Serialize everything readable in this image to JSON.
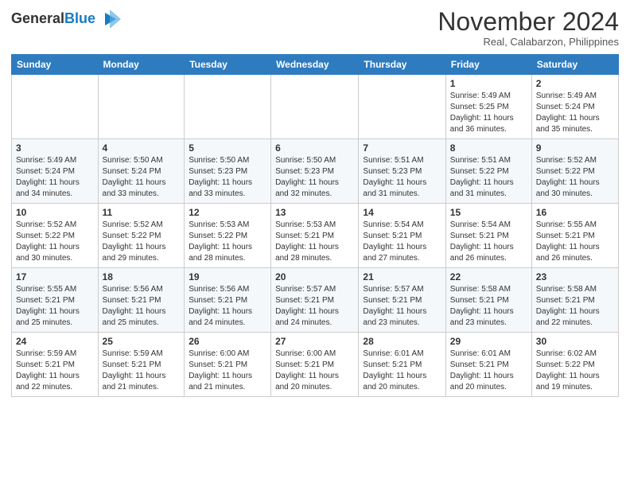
{
  "header": {
    "logo_general": "General",
    "logo_blue": "Blue",
    "month_title": "November 2024",
    "location": "Real, Calabarzon, Philippines"
  },
  "days_of_week": [
    "Sunday",
    "Monday",
    "Tuesday",
    "Wednesday",
    "Thursday",
    "Friday",
    "Saturday"
  ],
  "weeks": [
    [
      {
        "day": "",
        "info": ""
      },
      {
        "day": "",
        "info": ""
      },
      {
        "day": "",
        "info": ""
      },
      {
        "day": "",
        "info": ""
      },
      {
        "day": "",
        "info": ""
      },
      {
        "day": "1",
        "info": "Sunrise: 5:49 AM\nSunset: 5:25 PM\nDaylight: 11 hours\nand 36 minutes."
      },
      {
        "day": "2",
        "info": "Sunrise: 5:49 AM\nSunset: 5:24 PM\nDaylight: 11 hours\nand 35 minutes."
      }
    ],
    [
      {
        "day": "3",
        "info": "Sunrise: 5:49 AM\nSunset: 5:24 PM\nDaylight: 11 hours\nand 34 minutes."
      },
      {
        "day": "4",
        "info": "Sunrise: 5:50 AM\nSunset: 5:24 PM\nDaylight: 11 hours\nand 33 minutes."
      },
      {
        "day": "5",
        "info": "Sunrise: 5:50 AM\nSunset: 5:23 PM\nDaylight: 11 hours\nand 33 minutes."
      },
      {
        "day": "6",
        "info": "Sunrise: 5:50 AM\nSunset: 5:23 PM\nDaylight: 11 hours\nand 32 minutes."
      },
      {
        "day": "7",
        "info": "Sunrise: 5:51 AM\nSunset: 5:23 PM\nDaylight: 11 hours\nand 31 minutes."
      },
      {
        "day": "8",
        "info": "Sunrise: 5:51 AM\nSunset: 5:22 PM\nDaylight: 11 hours\nand 31 minutes."
      },
      {
        "day": "9",
        "info": "Sunrise: 5:52 AM\nSunset: 5:22 PM\nDaylight: 11 hours\nand 30 minutes."
      }
    ],
    [
      {
        "day": "10",
        "info": "Sunrise: 5:52 AM\nSunset: 5:22 PM\nDaylight: 11 hours\nand 30 minutes."
      },
      {
        "day": "11",
        "info": "Sunrise: 5:52 AM\nSunset: 5:22 PM\nDaylight: 11 hours\nand 29 minutes."
      },
      {
        "day": "12",
        "info": "Sunrise: 5:53 AM\nSunset: 5:22 PM\nDaylight: 11 hours\nand 28 minutes."
      },
      {
        "day": "13",
        "info": "Sunrise: 5:53 AM\nSunset: 5:21 PM\nDaylight: 11 hours\nand 28 minutes."
      },
      {
        "day": "14",
        "info": "Sunrise: 5:54 AM\nSunset: 5:21 PM\nDaylight: 11 hours\nand 27 minutes."
      },
      {
        "day": "15",
        "info": "Sunrise: 5:54 AM\nSunset: 5:21 PM\nDaylight: 11 hours\nand 26 minutes."
      },
      {
        "day": "16",
        "info": "Sunrise: 5:55 AM\nSunset: 5:21 PM\nDaylight: 11 hours\nand 26 minutes."
      }
    ],
    [
      {
        "day": "17",
        "info": "Sunrise: 5:55 AM\nSunset: 5:21 PM\nDaylight: 11 hours\nand 25 minutes."
      },
      {
        "day": "18",
        "info": "Sunrise: 5:56 AM\nSunset: 5:21 PM\nDaylight: 11 hours\nand 25 minutes."
      },
      {
        "day": "19",
        "info": "Sunrise: 5:56 AM\nSunset: 5:21 PM\nDaylight: 11 hours\nand 24 minutes."
      },
      {
        "day": "20",
        "info": "Sunrise: 5:57 AM\nSunset: 5:21 PM\nDaylight: 11 hours\nand 24 minutes."
      },
      {
        "day": "21",
        "info": "Sunrise: 5:57 AM\nSunset: 5:21 PM\nDaylight: 11 hours\nand 23 minutes."
      },
      {
        "day": "22",
        "info": "Sunrise: 5:58 AM\nSunset: 5:21 PM\nDaylight: 11 hours\nand 23 minutes."
      },
      {
        "day": "23",
        "info": "Sunrise: 5:58 AM\nSunset: 5:21 PM\nDaylight: 11 hours\nand 22 minutes."
      }
    ],
    [
      {
        "day": "24",
        "info": "Sunrise: 5:59 AM\nSunset: 5:21 PM\nDaylight: 11 hours\nand 22 minutes."
      },
      {
        "day": "25",
        "info": "Sunrise: 5:59 AM\nSunset: 5:21 PM\nDaylight: 11 hours\nand 21 minutes."
      },
      {
        "day": "26",
        "info": "Sunrise: 6:00 AM\nSunset: 5:21 PM\nDaylight: 11 hours\nand 21 minutes."
      },
      {
        "day": "27",
        "info": "Sunrise: 6:00 AM\nSunset: 5:21 PM\nDaylight: 11 hours\nand 20 minutes."
      },
      {
        "day": "28",
        "info": "Sunrise: 6:01 AM\nSunset: 5:21 PM\nDaylight: 11 hours\nand 20 minutes."
      },
      {
        "day": "29",
        "info": "Sunrise: 6:01 AM\nSunset: 5:21 PM\nDaylight: 11 hours\nand 20 minutes."
      },
      {
        "day": "30",
        "info": "Sunrise: 6:02 AM\nSunset: 5:22 PM\nDaylight: 11 hours\nand 19 minutes."
      }
    ]
  ]
}
